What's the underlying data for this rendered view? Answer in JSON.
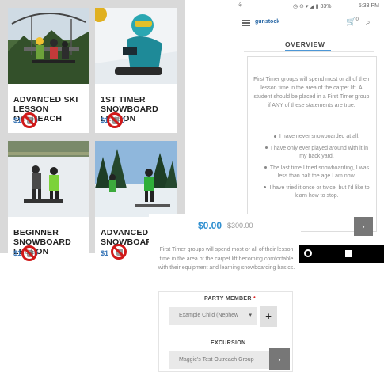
{
  "products": [
    {
      "title_line1": "ADVANCED SKI",
      "title_line2": "LESSON OUTREACH",
      "price_partial": "$1",
      "price_tail": "0"
    },
    {
      "title_line1": "1ST TIMER",
      "title_line2": "SNOWBOARD LESSON",
      "price_partial": "$1",
      "price_tail": "0"
    },
    {
      "title_line1": "BEGINNER",
      "title_line2": "SNOWBOARD LESSON",
      "price_partial": "$1",
      "price_tail": "0"
    },
    {
      "title_line1": "ADVANCED",
      "title_line2": "SNOWBOARD L",
      "price_partial": "$1",
      "price_tail": ""
    }
  ],
  "status_bar": {
    "battery": "33%",
    "time": "5:33 PM"
  },
  "app_bar": {
    "logo": "gunstock",
    "cart_count": "0"
  },
  "tab": {
    "label": "OVERVIEW"
  },
  "overview": {
    "intro": "First Timer groups will spend most or all of their lesson time in the area of the carpet lift. A student should be placed in a First Timer group if ANY of these statements are true:",
    "bullets": [
      "I have never snowboarded at all.",
      "I have only ever played around with it in my back yard.",
      "The last time I tried snowboarding, I was less than half the age I am now.",
      "I have tried it once or twice, but I'd like to learn how to stop."
    ]
  },
  "lower": {
    "price_now": "$0.00",
    "price_old": "$300.00",
    "description": "First Timer groups will spend most or all of their lesson time in the area of the carpet lift becoming comfortable with their equipment and learning snowboarding basics.",
    "party_member_label": "PARTY MEMBER",
    "required_marker": "*",
    "party_member_value": "Example Child (Nephew",
    "add_label": "+",
    "excursion_label": "EXCURSION",
    "excursion_value": "Maggie's Test Outreach Group"
  },
  "colors": {
    "accent": "#2f8fd0",
    "tab_underline": "#4c97d6",
    "blocked": "#d01919"
  }
}
